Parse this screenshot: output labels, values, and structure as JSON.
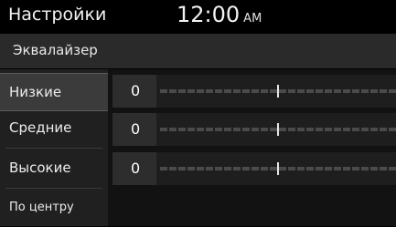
{
  "status_bar": {
    "title": "Настройки",
    "time": "12:00",
    "ampm": "AM"
  },
  "header": {
    "label": "Эквалайзер"
  },
  "sidebar": {
    "items": [
      {
        "label": "Низкие"
      },
      {
        "label": "Средние"
      },
      {
        "label": "Высокие"
      },
      {
        "label": "По центру"
      }
    ]
  },
  "equalizer": {
    "bands": [
      {
        "name": "Низкие",
        "value": "0",
        "level": 0.5
      },
      {
        "name": "Средние",
        "value": "0",
        "level": 0.5
      },
      {
        "name": "Высокие",
        "value": "0",
        "level": 0.5
      }
    ]
  }
}
